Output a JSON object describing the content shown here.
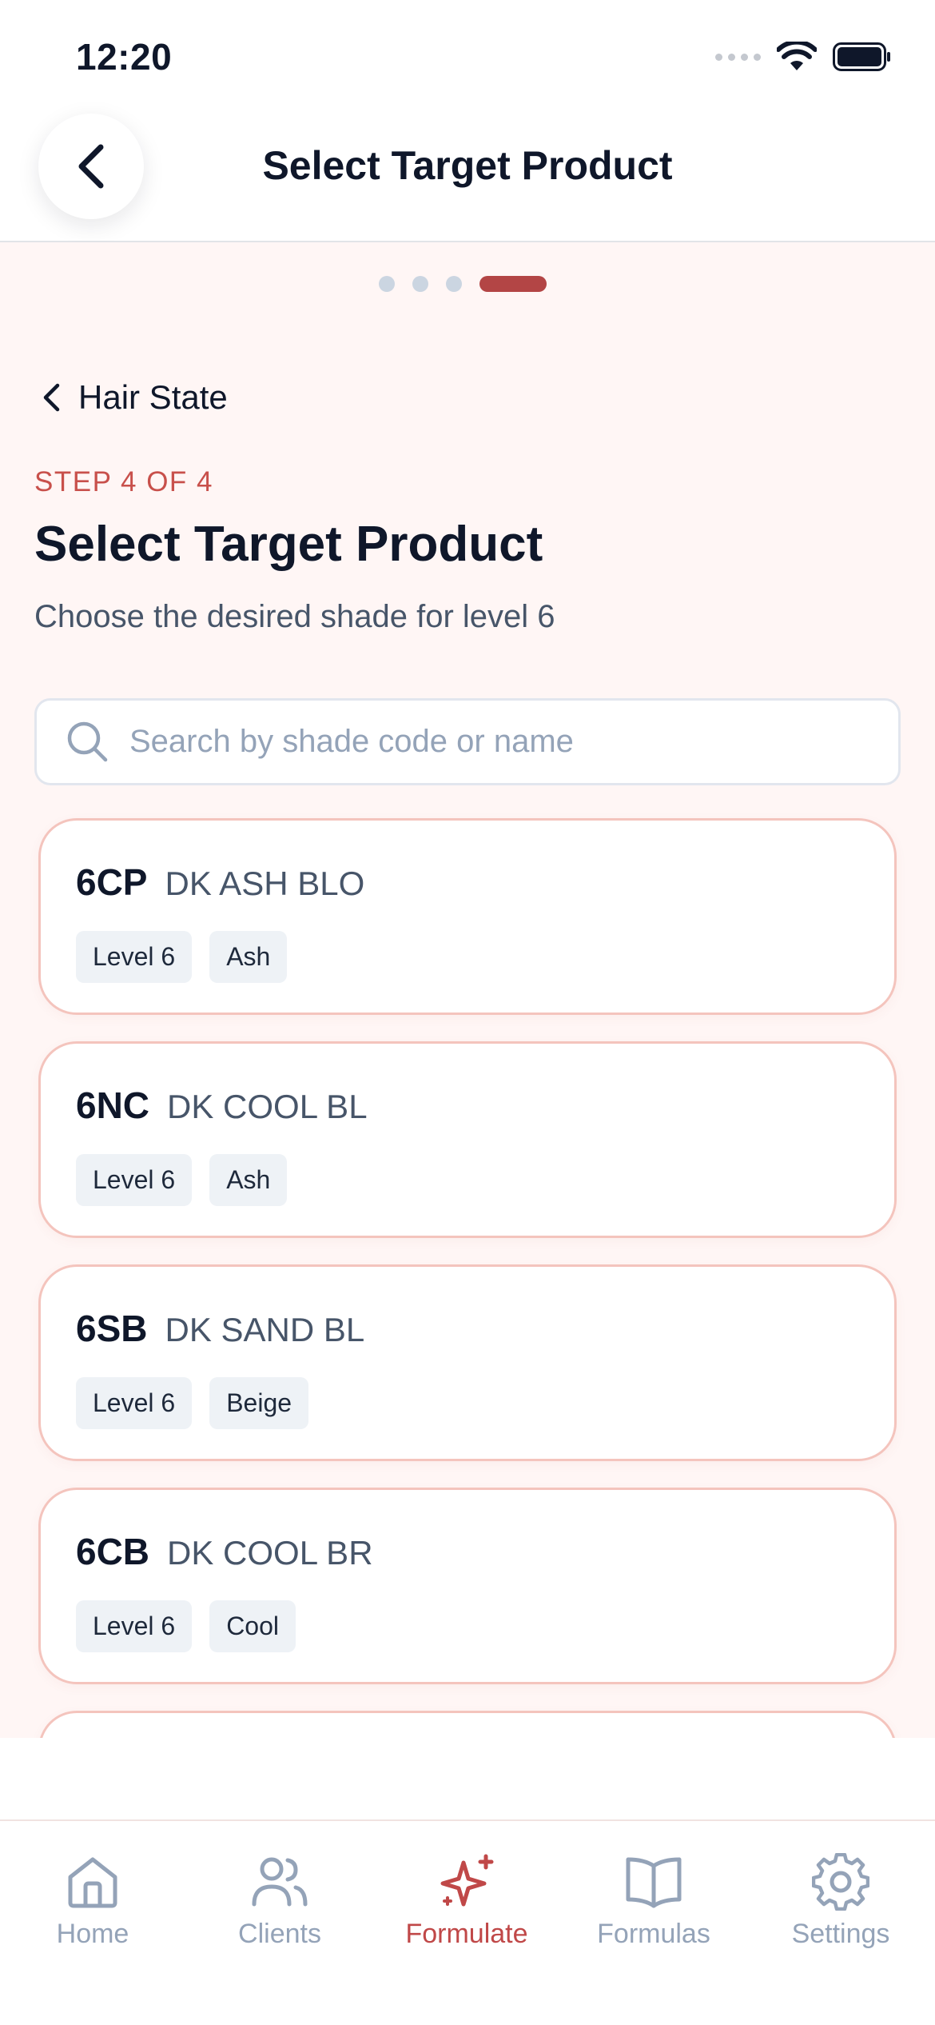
{
  "status": {
    "time": "12:20"
  },
  "header": {
    "title": "Select Target Product"
  },
  "progress": {
    "total": 4,
    "current": 4
  },
  "back_link": {
    "label": "Hair State"
  },
  "step": {
    "label": "STEP 4 OF 4"
  },
  "page": {
    "title": "Select Target Product",
    "subtitle": "Choose the desired shade for level 6"
  },
  "search": {
    "placeholder": "Search by shade code or name",
    "value": ""
  },
  "products": [
    {
      "code": "6CP",
      "name": "DK ASH BLO",
      "tags": [
        "Level 6",
        "Ash"
      ]
    },
    {
      "code": "6NC",
      "name": "DK COOL BL",
      "tags": [
        "Level 6",
        "Ash"
      ]
    },
    {
      "code": "6SB",
      "name": "DK SAND BL",
      "tags": [
        "Level 6",
        "Beige"
      ]
    },
    {
      "code": "6CB",
      "name": "DK COOL BR",
      "tags": [
        "Level 6",
        "Cool"
      ]
    }
  ],
  "tabbar": {
    "active": "Formulate",
    "tabs": [
      {
        "label": "Home",
        "icon": "home-icon"
      },
      {
        "label": "Clients",
        "icon": "users-icon"
      },
      {
        "label": "Formulate",
        "icon": "sparkles-icon"
      },
      {
        "label": "Formulas",
        "icon": "book-icon"
      },
      {
        "label": "Settings",
        "icon": "gear-icon"
      }
    ]
  },
  "colors": {
    "accent": "#b34545",
    "tab_active": "#c04848",
    "step_label": "#c8504b",
    "content_bg": "#fff6f5",
    "card_border": "#f4c4bd",
    "tag_bg": "#eef2f6",
    "muted": "#94a3b8"
  }
}
